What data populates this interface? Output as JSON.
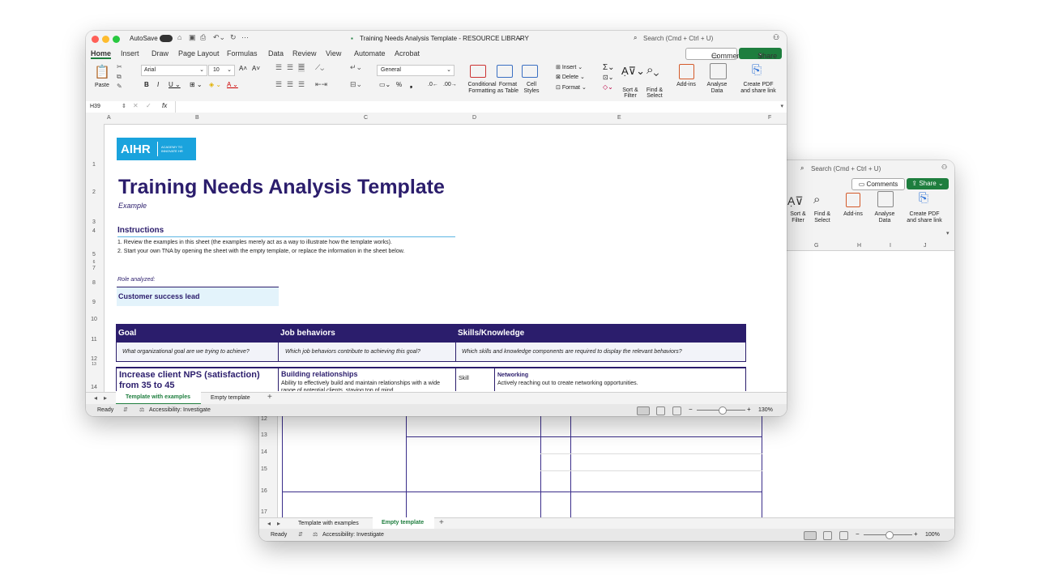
{
  "back": {
    "search_placeholder": "Search (Cmd + Ctrl + U)",
    "comments_label": "Comments",
    "share_label": "Share",
    "ribbon": [
      {
        "label1": "Sort &",
        "label2": "Filter"
      },
      {
        "label1": "Find &",
        "label2": "Select"
      },
      {
        "label1": "Add-ins",
        "label2": ""
      },
      {
        "label1": "Analyse",
        "label2": "Data"
      },
      {
        "label1": "Create PDF",
        "label2": "and share link"
      }
    ],
    "columns": [
      "G",
      "H",
      "I",
      "J"
    ],
    "rows": [
      "12",
      "13",
      "14",
      "15",
      "16",
      "17"
    ],
    "sheet_tabs": [
      "Template with examples",
      "Empty template"
    ],
    "active_tab": "Empty template",
    "status_ready": "Ready",
    "status_accessibility": "Accessibility: Investigate",
    "zoom": "100%"
  },
  "front": {
    "autosave_label": "AutoSave",
    "window_title": "Training Needs Analysis Template - RESOURCE LIBRARY",
    "search_placeholder": "Search (Cmd + Ctrl + U)",
    "comments_label": "Comments",
    "share_label": "Share",
    "tabs": [
      "Home",
      "Insert",
      "Draw",
      "Page Layout",
      "Formulas",
      "Data",
      "Review",
      "View",
      "Automate",
      "Acrobat"
    ],
    "active_tab": "Home",
    "paste_label": "Paste",
    "font_name": "Arial",
    "font_size": "10",
    "number_format": "General",
    "ribbon_groups": [
      {
        "label1": "Conditional",
        "label2": "Formatting"
      },
      {
        "label1": "Format",
        "label2": "as Table"
      },
      {
        "label1": "Cell",
        "label2": "Styles"
      },
      {
        "label1": "Sort &",
        "label2": "Filter"
      },
      {
        "label1": "Find &",
        "label2": "Select"
      },
      {
        "label1": "Add-ins",
        "label2": ""
      },
      {
        "label1": "Analyse",
        "label2": "Data"
      },
      {
        "label1": "Create PDF",
        "label2": "and share link"
      }
    ],
    "cells_menu": [
      "Insert",
      "Delete",
      "Format"
    ],
    "cell_ref": "H39",
    "fx_label": "fx",
    "columns": [
      "A",
      "B",
      "C",
      "D",
      "E",
      "F"
    ],
    "rows": [
      "1",
      "2",
      "3",
      "4",
      "5",
      "6",
      "7",
      "8",
      "9",
      "10",
      "11",
      "12",
      "13",
      "14"
    ],
    "sheet_tabs": [
      "Template with examples",
      "Empty template"
    ],
    "active_sheet": "Template with examples",
    "status_ready": "Ready",
    "status_accessibility": "Accessibility: Investigate",
    "zoom": "130%"
  },
  "sheet": {
    "logo_text": "AIHR",
    "logo_sub1": "ACADEMY TO",
    "logo_sub2": "INNOVATE HR",
    "title": "Training Needs Analysis Template",
    "subtitle": "Example",
    "instructions_heading": "Instructions",
    "instruction_1": "1. Review the examples in this sheet (the examples merely act as a way to illustrate how the template works).",
    "instruction_2": "2. Start your own TNA by opening the sheet with the empty template, or replace the information in the sheet below.",
    "role_label": "Role analyzed:",
    "role_value": "Customer success lead",
    "headers": [
      "Goal",
      "Job behaviors",
      "Skills/Knowledge"
    ],
    "questions": [
      "What organizational goal are we trying to achieve?",
      "Which job behaviors contribute to achieving this goal?",
      "Which skills and knowledge components are required to display the relevant behaviors?"
    ],
    "goal_value": "Increase client NPS (satisfaction) from 35 to 45",
    "behavior_title": "Building relationships",
    "behavior_desc": "Ability to effectively build and maintain relationships with a wide range of potential clients, staying top of mind",
    "skill_type": "Skill",
    "skill_title": "Networking",
    "skill_desc": "Actively reaching out to create networking opportunities."
  },
  "colors": {
    "navy": "#2b1d6c",
    "excel_green": "#1e7e3e",
    "logo_blue": "#1aa3dd",
    "role_fill": "#e3f3fb"
  }
}
